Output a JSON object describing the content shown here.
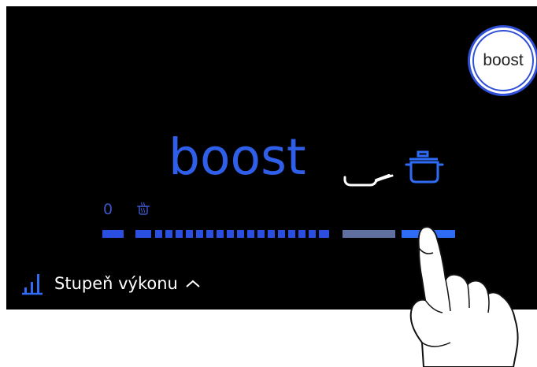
{
  "boost_button": {
    "label": "boost"
  },
  "level": {
    "value": "boost"
  },
  "scale": {
    "zero_label": "0"
  },
  "power_slider": {
    "segments": 19,
    "selected_segments": 17,
    "value_label": "boost"
  },
  "footer": {
    "label": "Stupeň výkonu"
  },
  "icons": [
    "pan-icon",
    "pot-icon",
    "steam-icon",
    "bar-chart-icon",
    "chevron-up-icon",
    "hand-pointer-icon"
  ],
  "colors": {
    "panel_bg": "#000000",
    "accent_blue": "#2f5ee8",
    "segment_blue": "#2a4fe0",
    "segment_gray": "#5e6fa0",
    "active_blue": "#2f6cf5",
    "text_white": "#ffffff"
  }
}
